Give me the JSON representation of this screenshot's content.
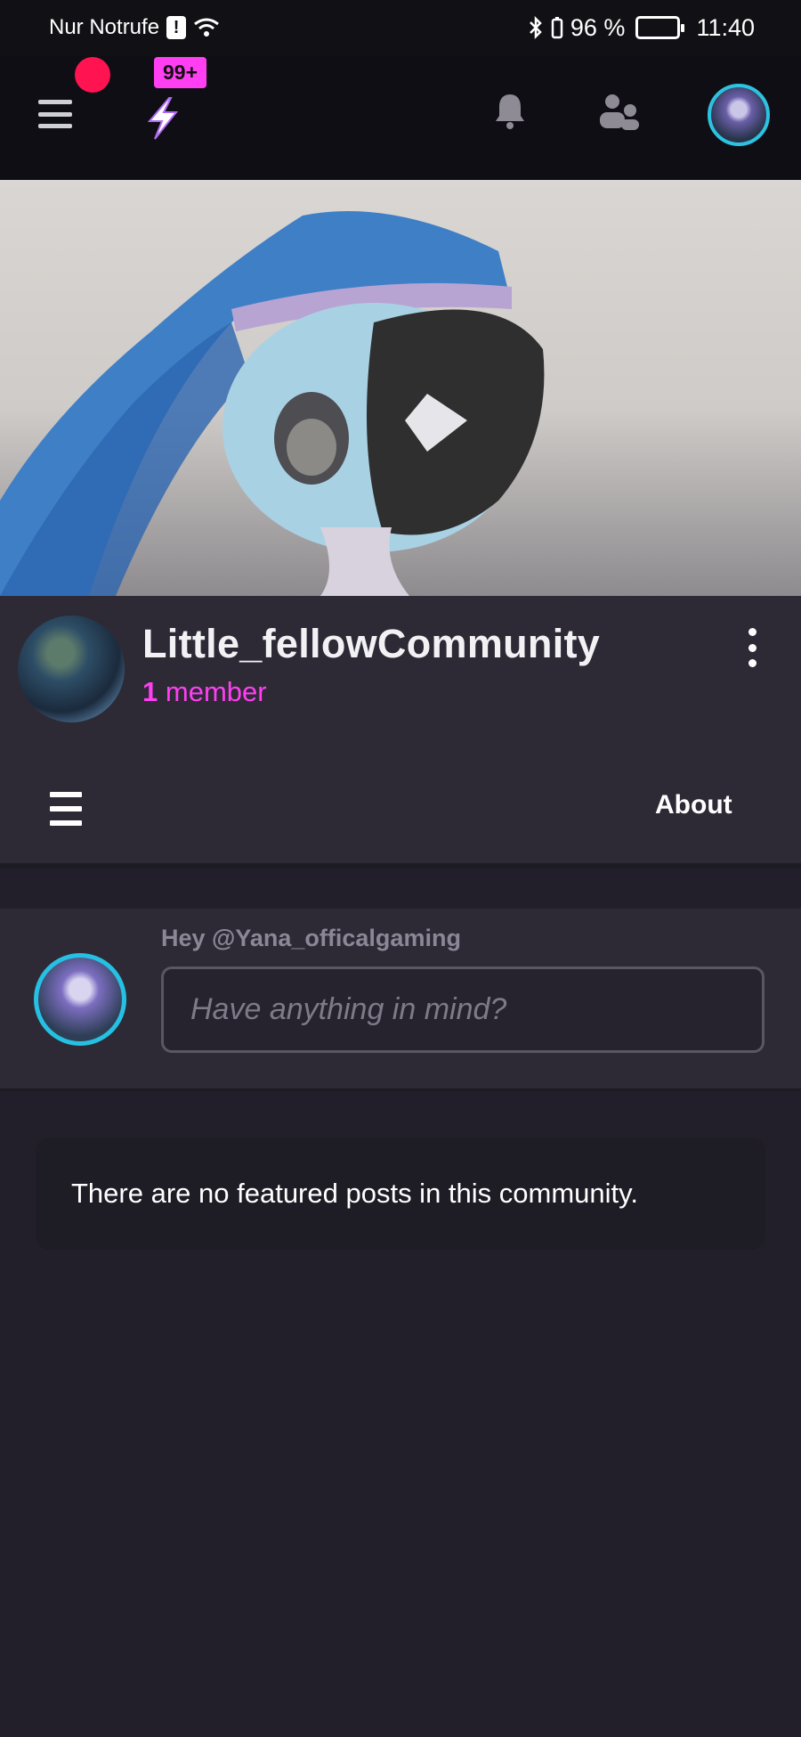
{
  "status_bar": {
    "carrier": "Nur Notrufe",
    "battery_percent": "96 %",
    "time": "11:40"
  },
  "top_bar": {
    "notification_badge": "99+",
    "icons": [
      "menu-icon",
      "bolt-icon",
      "bell-icon",
      "add-user-icon",
      "avatar"
    ],
    "accent_color": "#ff3ff1",
    "dot_color": "#ff1451"
  },
  "community": {
    "name": "Little_fellowCommunity",
    "member_count": "1",
    "member_label": "member"
  },
  "tabs": {
    "about_label": "About"
  },
  "compose": {
    "greeting": "Hey @Yana_officalgaming",
    "placeholder": "Have anything in mind?"
  },
  "featured": {
    "empty_message": "There are no featured posts in this community."
  }
}
